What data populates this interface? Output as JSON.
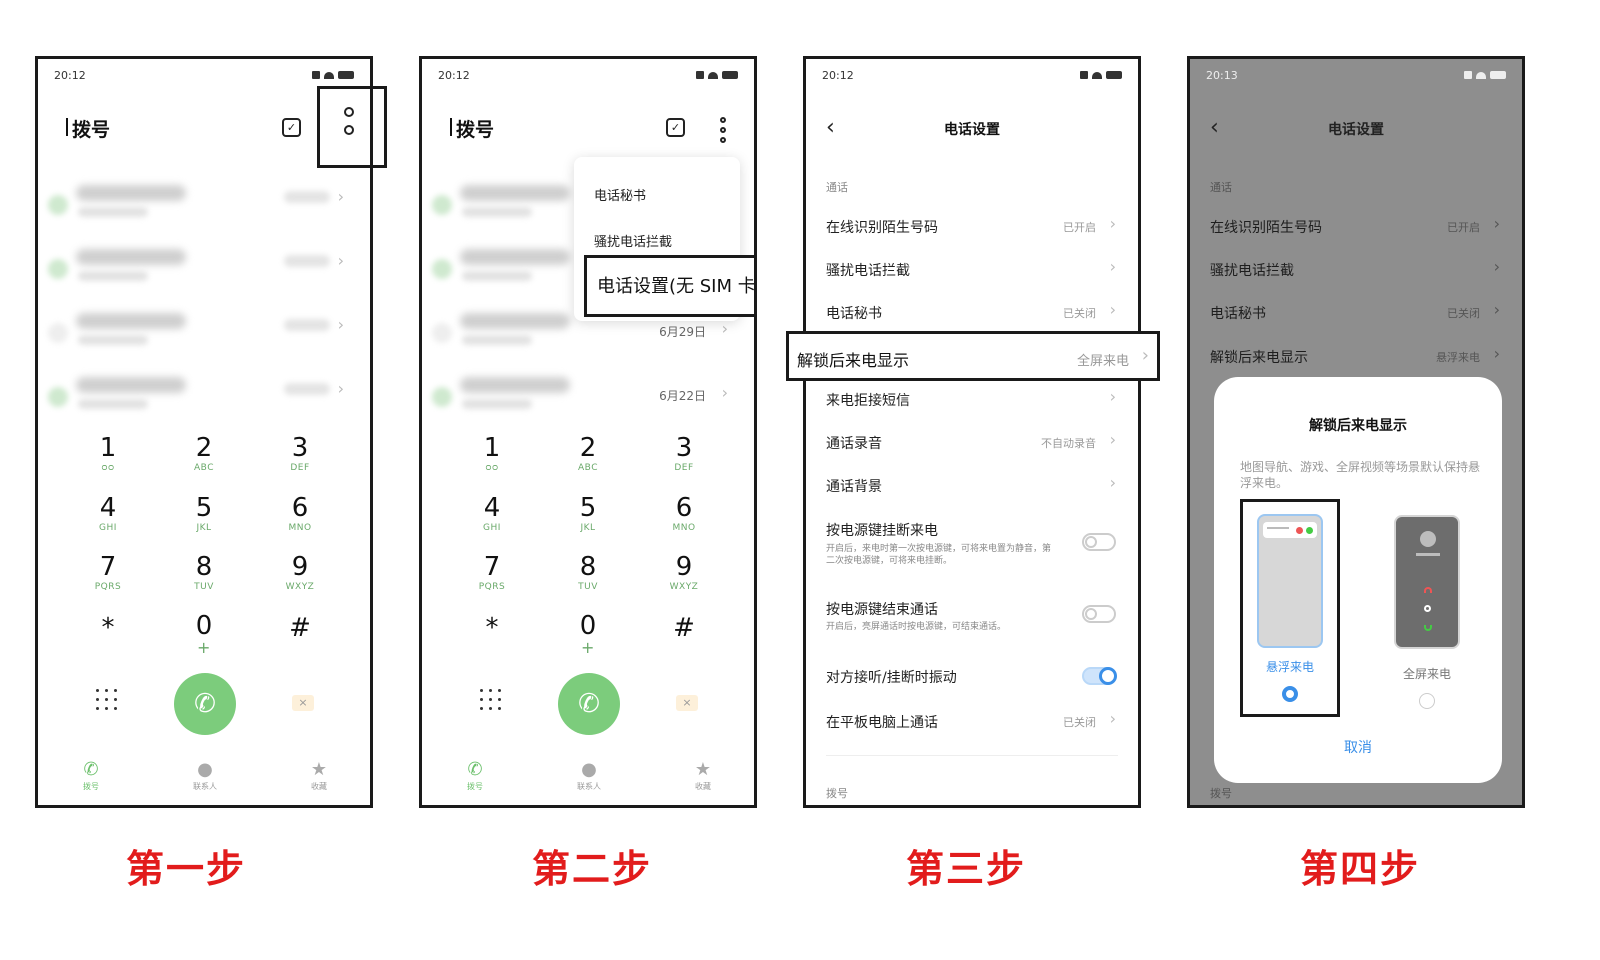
{
  "statusbar": {
    "time_1": "20:12",
    "time_2": "20:12",
    "time_3": "20:12",
    "time_4": "20:13"
  },
  "dialer": {
    "title": "拨号",
    "keys": [
      {
        "digit": "1",
        "letters": "ᴑᴑ"
      },
      {
        "digit": "2",
        "letters": "ABC"
      },
      {
        "digit": "3",
        "letters": "DEF"
      },
      {
        "digit": "4",
        "letters": "GHI"
      },
      {
        "digit": "5",
        "letters": "JKL"
      },
      {
        "digit": "6",
        "letters": "MNO"
      },
      {
        "digit": "7",
        "letters": "PQRS"
      },
      {
        "digit": "8",
        "letters": "TUV"
      },
      {
        "digit": "9",
        "letters": "WXYZ"
      },
      {
        "digit": "*",
        "letters": ""
      },
      {
        "digit": "0",
        "letters": "+"
      },
      {
        "digit": "#",
        "letters": ""
      }
    ],
    "tabs": [
      "拨号",
      "联系人",
      "收藏"
    ],
    "dates": [
      "6月29日",
      "6月22日"
    ]
  },
  "menu": {
    "items": [
      "电话秘书",
      "骚扰电话拦截",
      "电话设置(无 SIM 卡)"
    ]
  },
  "settings": {
    "back": "‹",
    "title": "电话设置",
    "section_call": "通话",
    "section_dial": "拨号",
    "rows": [
      {
        "label": "在线识别陌生号码",
        "value": "已开启"
      },
      {
        "label": "骚扰电话拦截",
        "value": ""
      },
      {
        "label": "电话秘书",
        "value": "已关闭"
      },
      {
        "label": "解锁后来电显示",
        "value": "全屏来电"
      },
      {
        "label": "来电拒接短信",
        "value": ""
      },
      {
        "label": "通话录音",
        "value": "不自动录音"
      },
      {
        "label": "通话背景",
        "value": ""
      }
    ],
    "power_hangup": {
      "label": "按电源键挂断来电",
      "desc": "开启后，来电时第一次按电源键，可将来电置为静音，第二次按电源键，可将来电挂断。"
    },
    "power_end": {
      "label": "按电源键结束通话",
      "desc": "开启后，亮屏通话时按电源键，可结束通话。"
    },
    "vibrate": {
      "label": "对方接听/挂断时振动"
    },
    "pc_call": {
      "label": "在平板电脑上通话",
      "value": "已关闭"
    }
  },
  "settings_p4": {
    "unlock_value": "悬浮来电"
  },
  "sheet": {
    "title": "解锁后来电显示",
    "desc": "地图导航、游戏、全屏视频等场景默认保持悬浮来电。",
    "option_float": "悬浮来电",
    "option_full": "全屏来电",
    "cancel": "取消"
  },
  "steps": [
    "第一步",
    "第二步",
    "第三步",
    "第四步"
  ],
  "colors": {
    "accent_green": "#7ccc7c",
    "accent_blue": "#3a8fe8",
    "step_red": "#e21c1c"
  }
}
